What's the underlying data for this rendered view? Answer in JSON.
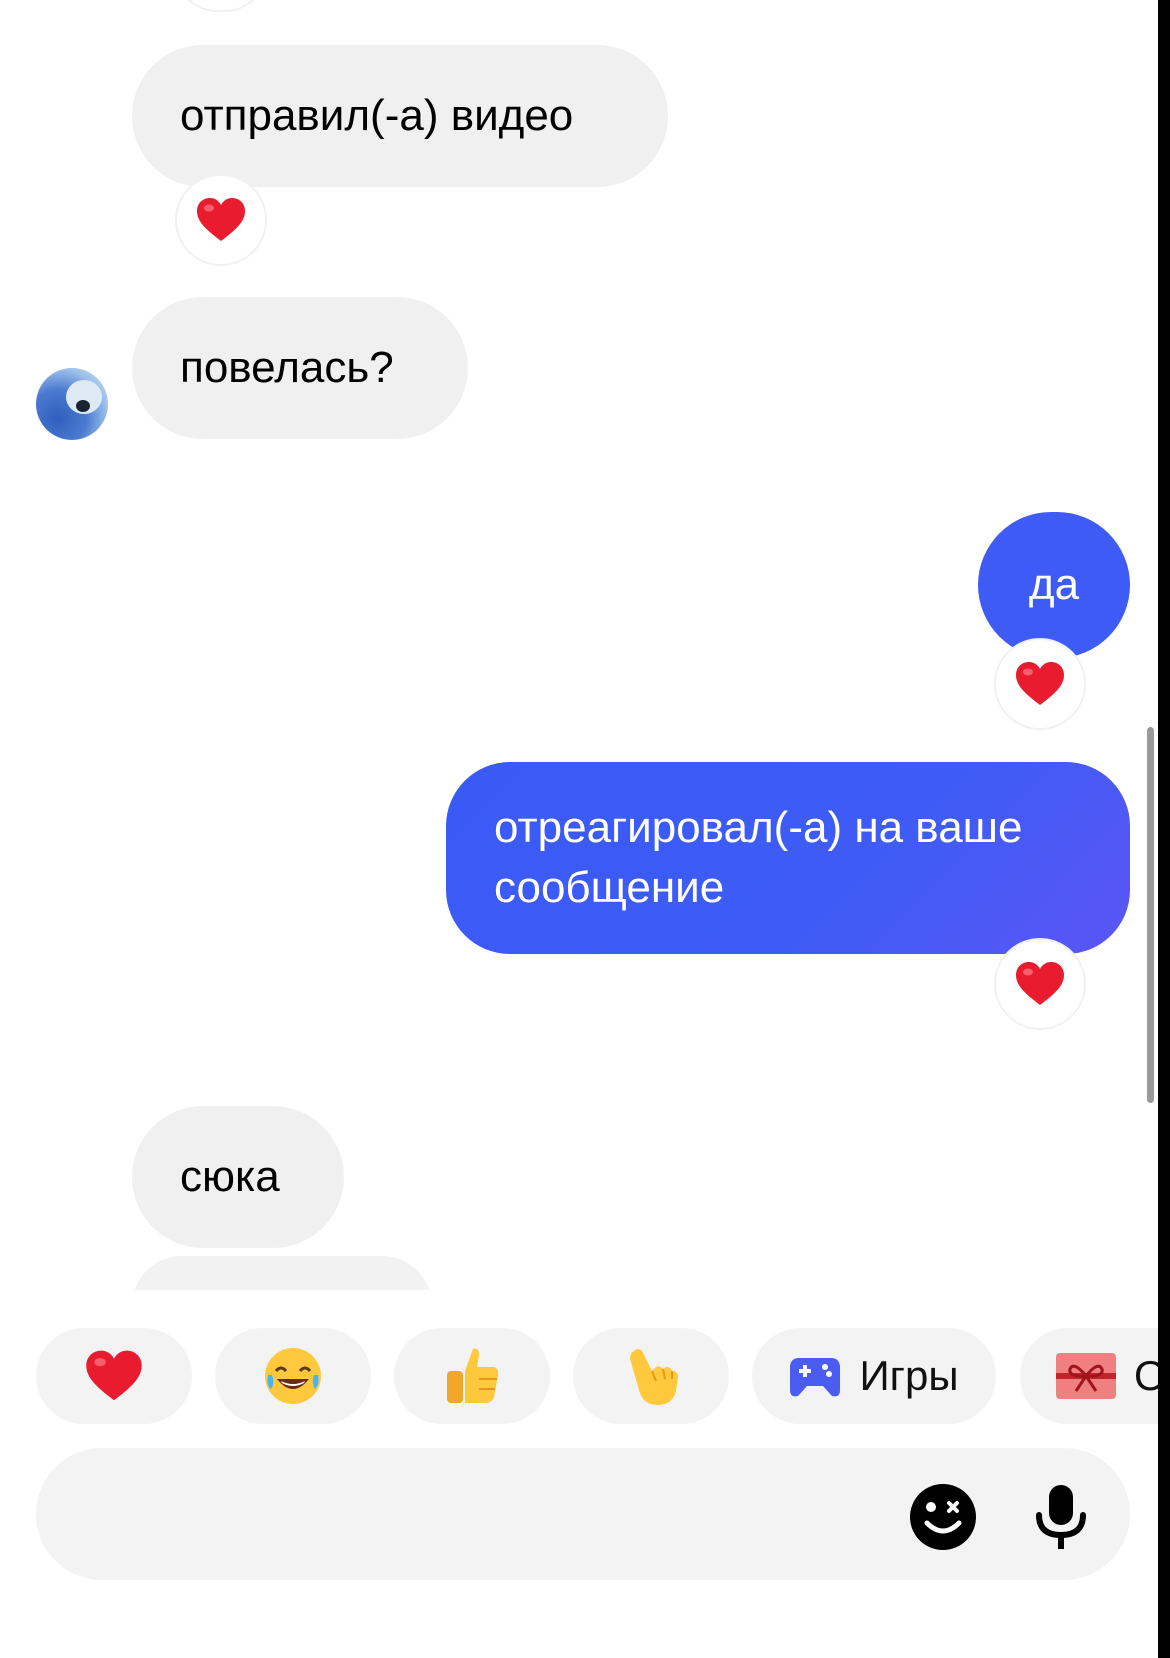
{
  "messages": [
    {
      "side": "in",
      "text": "отправил(-а) видео",
      "reaction": "heart"
    },
    {
      "side": "in",
      "text": "повелась?"
    },
    {
      "side": "out",
      "text": "да",
      "reaction": "heart"
    },
    {
      "side": "out",
      "text_line1": "отреагировал(-а) на ваше",
      "text_line2": "сообщение",
      "reaction": "heart"
    },
    {
      "side": "in",
      "text": "сюка"
    }
  ],
  "quick_reactions": [
    {
      "icon": "heart-icon",
      "label": ""
    },
    {
      "icon": "laughing-face-icon",
      "label": ""
    },
    {
      "icon": "thumbs-up-icon",
      "label": ""
    },
    {
      "icon": "pointing-hand-icon",
      "label": ""
    },
    {
      "icon": "gamepad-icon",
      "label": "Игры"
    },
    {
      "icon": "gift-icon",
      "label": "От"
    }
  ],
  "composer": {
    "placeholder": ""
  },
  "colors": {
    "outgoing": "#3e5cf5",
    "incoming": "#f0f0f0",
    "reaction": "#e81c2e"
  }
}
